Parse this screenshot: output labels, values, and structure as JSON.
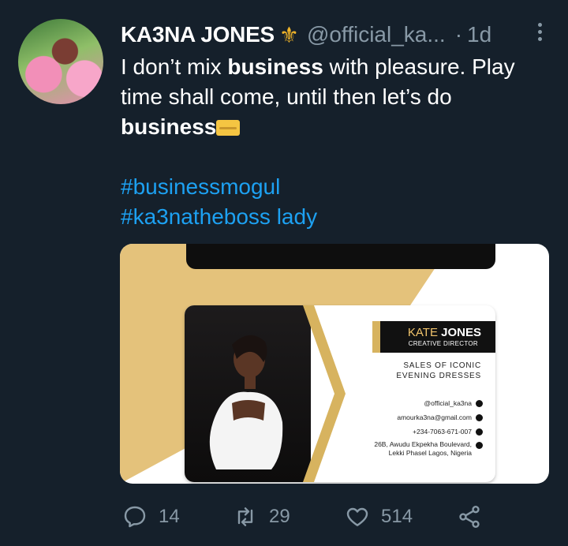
{
  "tweet": {
    "author_name": "KA3NA JONES",
    "author_emoji": "⚜",
    "handle": "@official_ka...",
    "separator": "·",
    "time": "1d",
    "text_line1_pre": "I don’t mix ",
    "text_bold1": "business",
    "text_line1_post": " with pleasure. Play time shall come, until then let’s do",
    "text_bold2": "business",
    "hashtag1": "#businessmogul",
    "hashtag2": "#ka3natheboss lady"
  },
  "card": {
    "first_name": "KATE",
    "last_name": "JONES",
    "role": "CREATIVE DIRECTOR",
    "sales_line1": "SALES OF ICONIC",
    "sales_line2": "EVENING DRESSES",
    "instagram": "@official_ka3na",
    "email": "amourka3na@gmail.com",
    "phone": "+234-7063-671-007",
    "address_line1": "26B, Awudu Ekpekha Boulevard,",
    "address_line2": "Lekki Phasel Lagos, Nigeria"
  },
  "actions": {
    "replies": "14",
    "retweets": "29",
    "likes": "514"
  },
  "icons": {
    "reply": "reply-icon",
    "retweet": "retweet-icon",
    "like": "heart-icon",
    "share": "share-icon",
    "more": "more-icon"
  },
  "colors": {
    "background": "#15202b",
    "secondary_text": "#8899a6",
    "link": "#1da1f2",
    "gold": "#e4c27b"
  }
}
